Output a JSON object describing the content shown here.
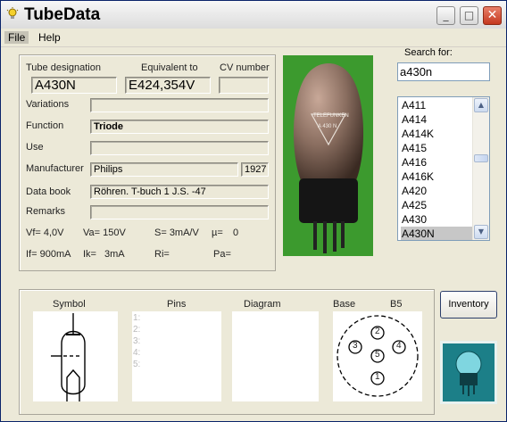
{
  "window": {
    "title": "TubeData",
    "minimize": "_",
    "maximize": "□",
    "close": "✕"
  },
  "menu": {
    "file": "File",
    "help": "Help"
  },
  "details": {
    "tube_designation_label": "Tube designation",
    "tube_designation": "A430N",
    "equivalent_label": "Equivalent to",
    "equivalent": "E424,354V",
    "cv_label": "CV number",
    "cv": "",
    "variations_label": "Variations",
    "variations": "",
    "function_label": "Function",
    "function": "Triode",
    "use_label": "Use",
    "use": "",
    "manufacturer_label": "Manufacturer",
    "manufacturer": "Philips",
    "year": "1927",
    "databook_label": "Data book",
    "databook": "Röhren. T-buch 1 J.S. -47",
    "remarks_label": "Remarks",
    "remarks": ""
  },
  "params": {
    "vf": "Vf= 4,0V",
    "va": "Va= 150V",
    "s": "S= 3mA/V",
    "mu": "µ=",
    "mu_val": "0",
    "if": "If= 900mA",
    "ik": "Ik=",
    "ik_val": "3mA",
    "ri": "Ri=",
    "pa": "Pa="
  },
  "photo": {
    "label": "TELEFUNKEN",
    "tube_text": "A 430 N"
  },
  "search": {
    "label": "Search for:",
    "value": "a430n"
  },
  "tube_list": [
    "A411",
    "A414",
    "A414K",
    "A415",
    "A416",
    "A416K",
    "A420",
    "A425",
    "A430",
    "A430N"
  ],
  "selected_tube": "A430N",
  "bottom": {
    "symbol_label": "Symbol",
    "pins_label": "Pins",
    "diagram_label": "Diagram",
    "base_label": "Base",
    "base_value": "B5",
    "pin_numbers": [
      "1:",
      "2:",
      "3:",
      "4:",
      "5:"
    ],
    "base_pins": [
      "1",
      "2",
      "3",
      "4",
      "5"
    ]
  },
  "inventory_button": "Inventory",
  "colors": {
    "photo_bg": "#3c9a2e",
    "logo_bg": "#1a7a82",
    "selection": "#c7c7c7"
  }
}
